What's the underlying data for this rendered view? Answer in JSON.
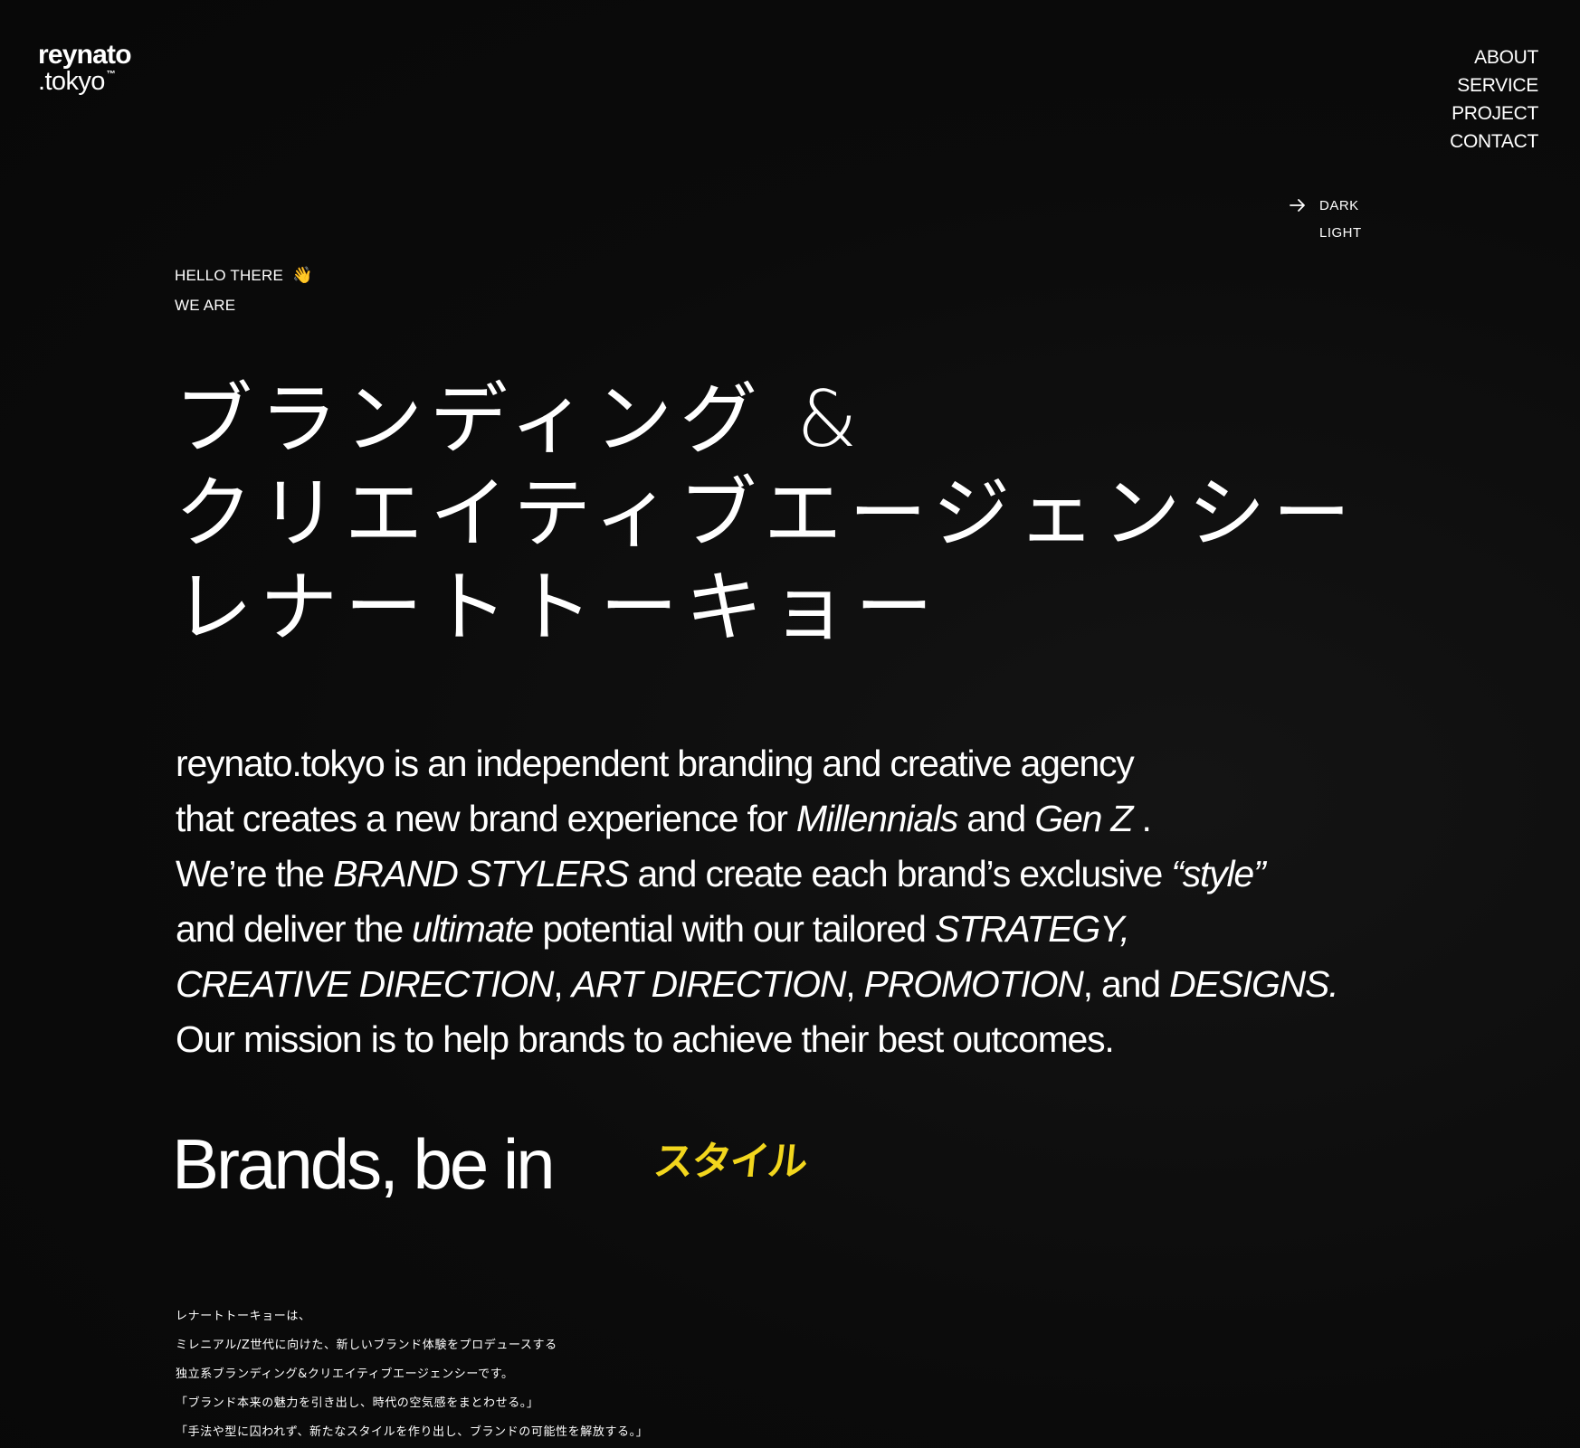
{
  "logo": {
    "top": "reynato",
    "bottom": ".tokyo",
    "tm": "™"
  },
  "nav": {
    "items": [
      "ABOUT",
      "SERVICE",
      "PROJECT",
      "CONTACT"
    ]
  },
  "theme": {
    "dark_label": "DARK",
    "light_label": "LIGHT",
    "active": "DARK"
  },
  "greeting": {
    "line1": "HELLO THERE",
    "line2": "WE ARE",
    "emoji": "👋"
  },
  "headline": {
    "lines": [
      "ブランディング &",
      "クリエイティブエージェンシー",
      "レナートトーキョー"
    ]
  },
  "intro": {
    "l1": "reynato.tokyo is an independent branding and creative agency",
    "l2_a": "that creates a new brand experience for ",
    "l2_b": "Millennials",
    "l2_c": " and ",
    "l2_d": "Gen Z",
    "l2_e": " .",
    "l3_a": "We’re the ",
    "l3_b": "BRAND STYLERS",
    "l3_c": " and create each brand’s exclusive ",
    "l3_d": "“style”",
    "l4_a": "and deliver the ",
    "l4_b": "ultimate",
    "l4_c": " potential with our tailored ",
    "l4_d": "STRATEGY,",
    "l5_a": "CREATIVE DIRECTION",
    "l5_b": ", ",
    "l5_c": "ART DIRECTION",
    "l5_d": ", ",
    "l5_e": "PROMOTION",
    "l5_f": ", and ",
    "l5_g": "DESIGNS.",
    "l6": "Our mission is to help brands to achieve their best outcomes."
  },
  "tagline": {
    "text": "Brands, be in",
    "accent": "スタイル",
    "accent_color": "#f2d61d"
  },
  "jp_body": {
    "lines": [
      "レナートトーキョーは、",
      "ミレニアル/Z世代に向けた、新しいブランド体験をプロデュースする",
      "独立系ブランディング&クリエイティブエージェンシーです。",
      "「ブランド本来の魅力を引き出し、時代の空気感をまとわせる。」",
      "「手法や型に囚われず、新たなスタイルを作り出し、ブランドの可能性を解放する。」"
    ]
  }
}
